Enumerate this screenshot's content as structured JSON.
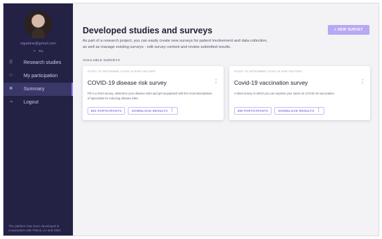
{
  "sidebar": {
    "email": "olgalane@gmail.com",
    "lang": "RU",
    "items": [
      {
        "label": "Research studies",
        "icon": "list-icon",
        "active": false
      },
      {
        "label": "My participation",
        "icon": "users-icon",
        "active": false
      },
      {
        "label": "Summary",
        "icon": "people-icon",
        "active": true
      },
      {
        "label": "Logout",
        "icon": "logout-icon",
        "active": false
      }
    ],
    "footer_note": "The platform has been developed in cooperation with PNIUL LU and SMC"
  },
  "main": {
    "title": "Developed studies and surveys",
    "new_survey_label": "+ NEW SURVEY",
    "intro": "As part of a research project, you can easily create new surveys for patient involvement and data collection, as well as manage existing surveys - edit survey content and review submitted results.",
    "section_label": "AVAILABLE SURVEYS"
  },
  "cards": [
    {
      "kicker": "STUDY TO DETERMINE COVID-19 RISK FACTORS",
      "title": "COVID-19 disease risk survey",
      "description": "Fill in a short survey, determine your disease risks and get acquainted with the recommendations of specialists for reducing disease risks.",
      "participants": "661 PARTICIPANTS",
      "download": "DOWNLOAD RESULTS"
    },
    {
      "kicker": "STUDY TO DETERMINE COVID-19 RISK FACTORS",
      "title": "Covid-19 vaccination survey",
      "description": "A short survey in which you can express your views on COVID-19 vaccination.",
      "participants": "496 PARTICIPANTS",
      "download": "DOWNLOAD RESULTS"
    }
  ],
  "colors": {
    "sidebar_bg": "#232144",
    "accent": "#8a73e8",
    "button_bg": "#b9a8f3",
    "page_bg": "#f3f3f6"
  }
}
